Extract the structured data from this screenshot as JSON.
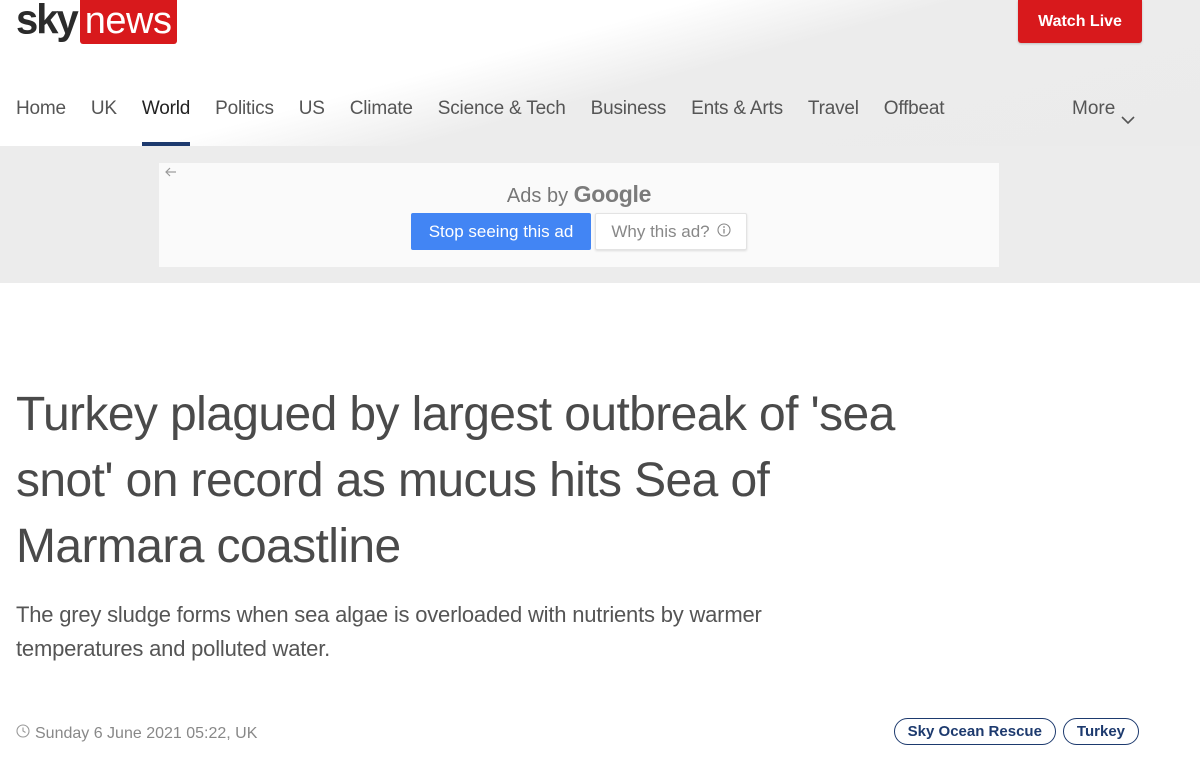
{
  "header": {
    "logo_sky": "sky",
    "logo_news": "news",
    "watch_live_label": "Watch Live"
  },
  "nav": {
    "items": [
      {
        "label": "Home"
      },
      {
        "label": "UK"
      },
      {
        "label": "World",
        "active": true
      },
      {
        "label": "Politics"
      },
      {
        "label": "US"
      },
      {
        "label": "Climate"
      },
      {
        "label": "Science & Tech"
      },
      {
        "label": "Business"
      },
      {
        "label": "Ents & Arts"
      },
      {
        "label": "Travel"
      },
      {
        "label": "Offbeat"
      }
    ],
    "more_label": "More"
  },
  "ad": {
    "ads_by": "Ads by",
    "google": "Google",
    "stop_label": "Stop seeing this ad",
    "why_label": "Why this ad?"
  },
  "article": {
    "headline": "Turkey plagued by largest outbreak of 'sea snot' on record as mucus hits Sea of Marmara coastline",
    "standfirst": "The grey sludge forms when sea algae is overloaded with nutrients by warmer temperatures and polluted water.",
    "timestamp": "Sunday 6 June 2021 05:22, UK",
    "tags": [
      {
        "label": "Sky Ocean Rescue"
      },
      {
        "label": "Turkey"
      }
    ]
  },
  "colors": {
    "brand_red": "#d8191c",
    "nav_active_underline": "#1d3a6e",
    "ad_button_blue": "#4285f4"
  }
}
